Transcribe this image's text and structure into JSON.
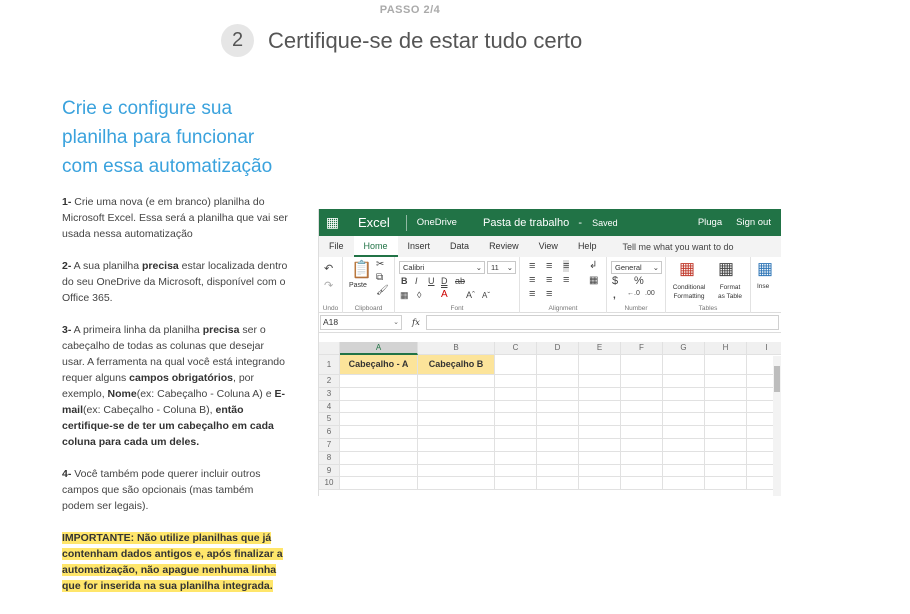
{
  "step": {
    "label": "PASSO 2/4",
    "number": "2",
    "title": "Certifique-se de estar tudo certo"
  },
  "instructions": {
    "title": "Crie e configure sua planilha para funcionar com essa automatização",
    "p1": {
      "num": "1-",
      "text": " Crie uma nova (e em branco) planilha do Microsoft Excel. Essa será a planilha que vai ser usada nessa automatização"
    },
    "p2": {
      "num": "2-",
      "t1": " A sua planilha ",
      "b1": "precisa",
      "t2": " estar localizada dentro do seu OneDrive da Microsoft, disponível com o Office 365."
    },
    "p3": {
      "num": "3-",
      "t1": " A primeira linha da planilha ",
      "b1": "precisa",
      "t2": " ser o cabeçalho de todas as colunas que desejar usar. A ferramenta na qual você está integrando requer alguns ",
      "b2": "campos obrigatórios",
      "t3": ", por exemplo, ",
      "b3": "Nome",
      "t4": "(ex: Cabeçalho - Coluna A) e ",
      "b4": "E-mail",
      "t5": "(ex: Cabeçalho - Coluna B), ",
      "b5": "então certifique-se de ter um cabeçalho em cada coluna para cada um deles."
    },
    "p4": {
      "num": "4-",
      "text": " Você também pode querer incluir outros campos que são opcionais (mas também podem ser legais)."
    },
    "important": "IMPORTANTE: Não utilize planilhas que já contenham dados antigos e, após finalizar a automatização, não apague nenhuma linha que for inserida na sua planilha integrada."
  },
  "excel": {
    "app": "Excel",
    "onedrive": "OneDrive",
    "doc": "Pasta de trabalho",
    "dash": "-",
    "saved": "Saved",
    "user": "Pluga",
    "signout": "Sign out",
    "tabs": [
      "File",
      "Home",
      "Insert",
      "Data",
      "Review",
      "View",
      "Help"
    ],
    "tellme": "Tell me what you want to do",
    "ribbon": {
      "undo": "Undo",
      "paste": "Paste",
      "clipboard": "Clipboard",
      "font": "Calibri",
      "size": "11",
      "font_label": "Font",
      "alignment": "Alignment",
      "number_format": "General",
      "number": "Number",
      "conditional": "Conditional",
      "formatting": "Formatting",
      "format": "Format",
      "as_table": "as Table",
      "tables": "Tables",
      "insert": "Inse"
    },
    "namebox": "A18",
    "fx": "fx",
    "columns": [
      "A",
      "B",
      "C",
      "D",
      "E",
      "F",
      "G",
      "H",
      "I"
    ],
    "rows": [
      "1",
      "2",
      "3",
      "4",
      "5",
      "6",
      "7",
      "8",
      "9",
      "10"
    ],
    "header_a": "Cabeçalho - A",
    "header_b": "Cabeçalho B"
  }
}
